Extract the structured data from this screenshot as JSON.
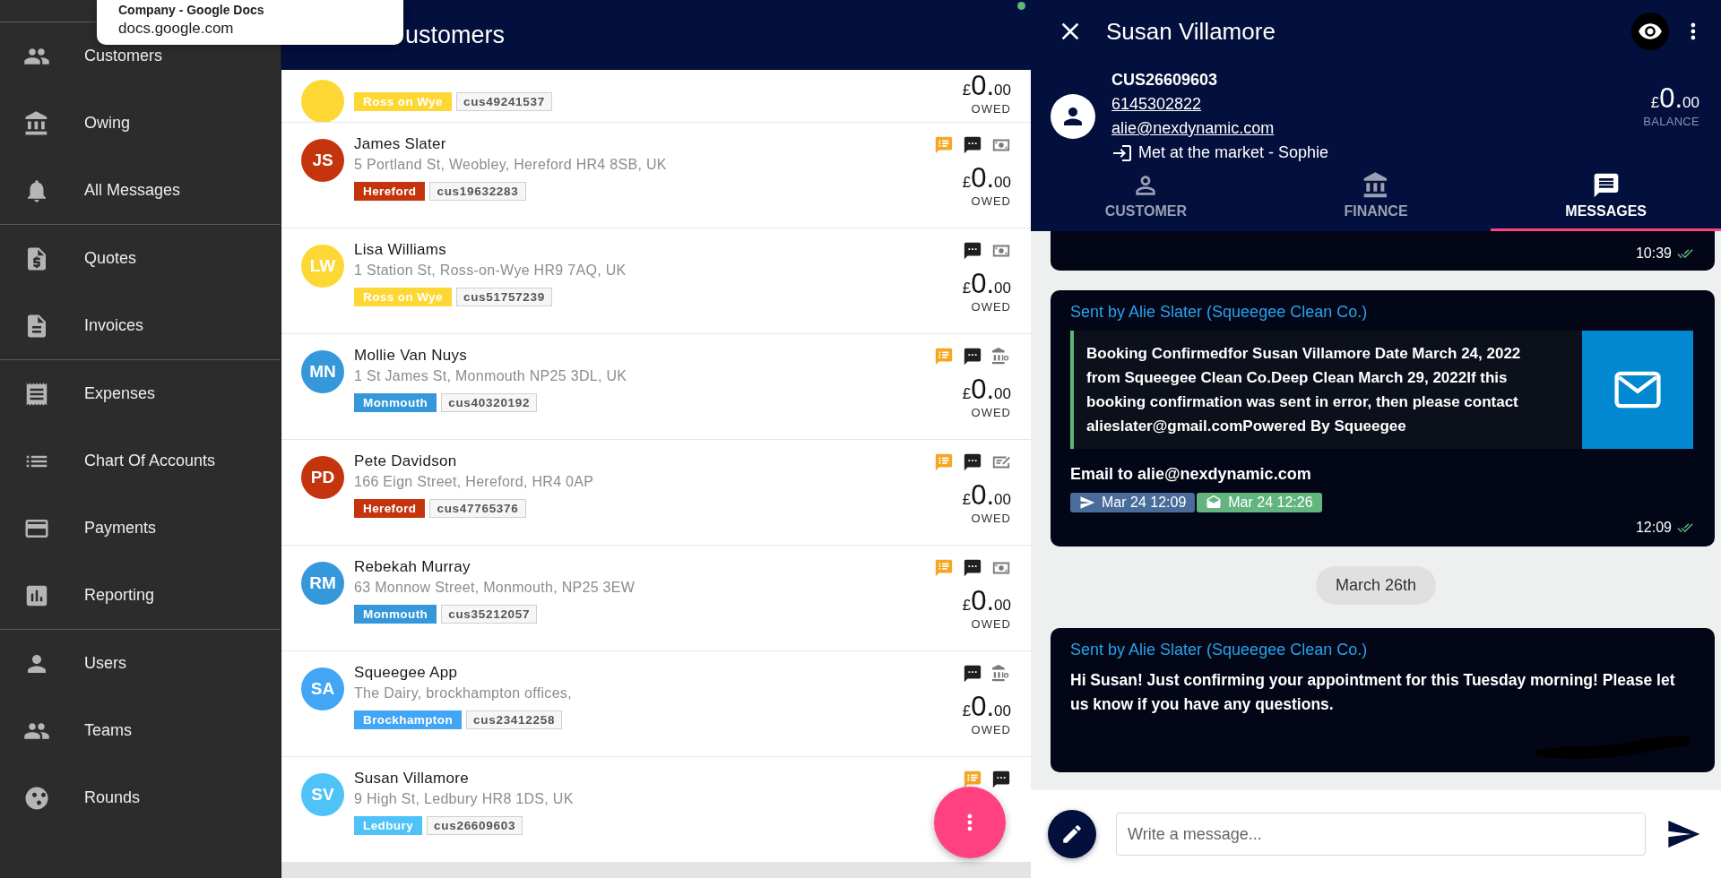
{
  "browser_tooltip": {
    "title": "Company - Google Docs",
    "url": "docs.google.com"
  },
  "sidebar": {
    "sections": [
      {
        "items": [
          {
            "label": "Customers"
          },
          {
            "label": "Owing"
          },
          {
            "label": "All Messages"
          }
        ]
      },
      {
        "items": [
          {
            "label": "Quotes"
          },
          {
            "label": "Invoices"
          }
        ]
      },
      {
        "items": [
          {
            "label": "Expenses"
          },
          {
            "label": "Chart Of Accounts"
          },
          {
            "label": "Payments"
          },
          {
            "label": "Reporting"
          }
        ]
      },
      {
        "items": [
          {
            "label": "Users"
          },
          {
            "label": "Teams"
          },
          {
            "label": "Rounds"
          }
        ]
      }
    ]
  },
  "customer_list": {
    "title": "ustomers",
    "customers": [
      {
        "kind": "partial",
        "avatar": {
          "color": "#fdd835"
        },
        "tag": {
          "label": "Ross on Wye",
          "color": "#fdd835"
        },
        "code": "cus49241537",
        "amount": {
          "currency": "£",
          "whole": "0.",
          "cents": "00",
          "label": "OWED"
        }
      },
      {
        "kind": "full",
        "name": "James Slater",
        "address": "5 Portland St, Weobley, Hereford HR4 8SB, UK",
        "avatar": {
          "initials": "JS",
          "color": "#c4350e"
        },
        "tag": {
          "label": "Hereford",
          "color": "#c4350e"
        },
        "code": "cus19632283",
        "indicators": [
          {
            "kind": "notes"
          },
          {
            "kind": "message"
          },
          {
            "kind": "cash"
          }
        ],
        "amount": {
          "currency": "£",
          "whole": "0.",
          "cents": "00",
          "label": "OWED"
        }
      },
      {
        "kind": "full",
        "name": "Lisa Williams",
        "address": "1 Station St, Ross-on-Wye HR9 7AQ, UK",
        "avatar": {
          "initials": "LW",
          "color": "#fdd835"
        },
        "tag": {
          "label": "Ross on Wye",
          "color": "#fdd835"
        },
        "code": "cus51757239",
        "indicators": [
          {
            "kind": "message"
          },
          {
            "kind": "cash"
          }
        ],
        "amount": {
          "currency": "£",
          "whole": "0.",
          "cents": "00",
          "label": "OWED"
        }
      },
      {
        "kind": "full",
        "name": "Mollie Van Nuys",
        "address": "1 St James St, Monmouth NP25 3DL, UK",
        "avatar": {
          "initials": "MN",
          "color": "#3498db"
        },
        "tag": {
          "label": "Monmouth",
          "color": "#3498db"
        },
        "code": "cus40320192",
        "indicators": [
          {
            "kind": "notes"
          },
          {
            "kind": "message"
          },
          {
            "kind": "bank"
          }
        ],
        "amount": {
          "currency": "£",
          "whole": "0.",
          "cents": "00",
          "label": "OWED"
        }
      },
      {
        "kind": "full",
        "name": "Pete Davidson",
        "address": "166 Eign Street, Hereford, HR4 0AP",
        "avatar": {
          "initials": "PD",
          "color": "#c4350e"
        },
        "tag": {
          "label": "Hereford",
          "color": "#c4350e"
        },
        "code": "cus47765376",
        "indicators": [
          {
            "kind": "notes"
          },
          {
            "kind": "message"
          },
          {
            "kind": "cheque"
          }
        ],
        "amount": {
          "currency": "£",
          "whole": "0.",
          "cents": "00",
          "label": "OWED"
        }
      },
      {
        "kind": "full",
        "name": "Rebekah Murray",
        "address": "63 Monnow Street, Monmouth, NP25 3EW",
        "avatar": {
          "initials": "RM",
          "color": "#3498db"
        },
        "tag": {
          "label": "Monmouth",
          "color": "#3498db"
        },
        "code": "cus35212057",
        "indicators": [
          {
            "kind": "notes"
          },
          {
            "kind": "message"
          },
          {
            "kind": "cash"
          }
        ],
        "amount": {
          "currency": "£",
          "whole": "0.",
          "cents": "00",
          "label": "OWED"
        }
      },
      {
        "kind": "full",
        "name": "Squeegee App",
        "address": "The Dairy, brockhampton offices,",
        "avatar": {
          "initials": "SA",
          "color": "#42a5f5"
        },
        "tag": {
          "label": "Brockhampton",
          "color": "#42a5f5"
        },
        "code": "cus23412258",
        "indicators": [
          {
            "kind": "message"
          },
          {
            "kind": "bank"
          }
        ],
        "amount": {
          "currency": "£",
          "whole": "0.",
          "cents": "00",
          "label": "OWED"
        }
      },
      {
        "kind": "full",
        "name": "Susan Villamore",
        "address": "9 High St, Ledbury HR8 1DS, UK",
        "avatar": {
          "initials": "SV",
          "color": "#4fc3f7"
        },
        "tag": {
          "label": "Ledbury",
          "color": "#4fc3f7"
        },
        "code": "cus26609603",
        "indicators": [
          {
            "kind": "notes"
          },
          {
            "kind": "message"
          }
        ]
      }
    ]
  },
  "detail": {
    "name": "Susan Villamore",
    "code": "CUS26609603",
    "phone": "6145302822",
    "email": "alie@nexdynamic.com",
    "source": "Met at the market - Sophie",
    "balance": {
      "currency": "£",
      "whole": "0.",
      "cents": "00",
      "label": "BALANCE"
    },
    "tabs": [
      {
        "label": "CUSTOMER",
        "selected": false
      },
      {
        "label": "FINANCE",
        "selected": false
      },
      {
        "label": "MESSAGES",
        "selected": true
      }
    ],
    "messages": [
      {
        "kind": "partial",
        "time": "10:39",
        "read": true
      },
      {
        "kind": "email",
        "sender": "Sent by Alie Slater (Squeegee Clean Co.)",
        "body": "Booking Confirmedfor Susan Villamore Date March 24, 2022 from Squeegee Clean Co.Deep Clean March 29, 2022If this booking confirmation was sent in error, then please contact alieslater@gmail.comPowered By Squeegee",
        "recipient": "Email to alie@nexdynamic.com",
        "events": [
          {
            "kind": "sent",
            "label": "Mar 24 12:09"
          },
          {
            "kind": "opened",
            "label": "Mar 24 12:26"
          }
        ],
        "time": "12:09",
        "read": true
      },
      {
        "kind": "date",
        "label": "March 26th"
      },
      {
        "kind": "text",
        "sender": "Sent by Alie Slater (Squeegee Clean Co.)",
        "body": "Hi Susan! Just confirming your appointment for this Tuesday morning! Please let us know if you have any questions.",
        "redacted": true
      }
    ],
    "compose": {
      "placeholder": "Write a message..."
    }
  }
}
